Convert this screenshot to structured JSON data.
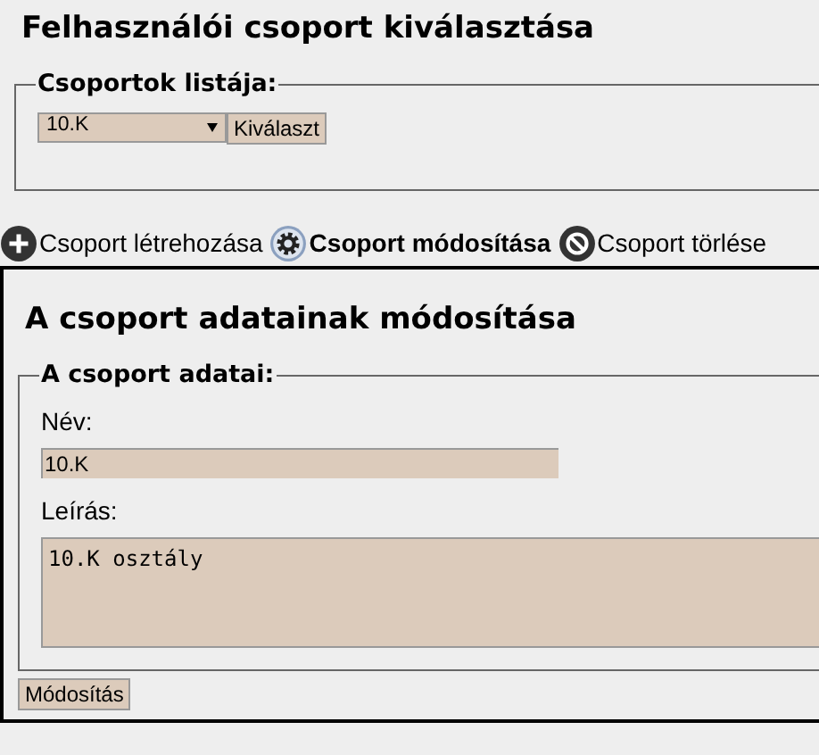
{
  "title": "Felhasználói csoport kiválasztása",
  "group_select": {
    "legend": "Csoportok listája:",
    "value": "10.K",
    "button": "Kiválaszt"
  },
  "tabs": [
    {
      "label": "Csoport létrehozása",
      "kind": "create",
      "selected": false
    },
    {
      "label": "Csoport módosítása",
      "kind": "modify",
      "selected": true
    },
    {
      "label": "Csoport törlése",
      "kind": "delete",
      "selected": false
    }
  ],
  "panel": {
    "title": "A csoport adatainak módosítása",
    "legend": "A csoport adatai:",
    "fields": [
      {
        "label": "Név:",
        "kind": "text",
        "value": "10.K"
      },
      {
        "label": "Leírás:",
        "kind": "textarea",
        "value": "10.K osztály"
      }
    ],
    "button": "Módosítás"
  }
}
